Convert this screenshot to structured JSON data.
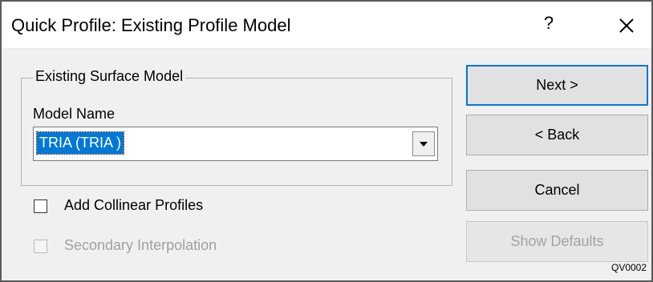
{
  "window": {
    "title": "Quick Profile: Existing Profile Model",
    "help_label": "?",
    "close_icon": "close-icon"
  },
  "group": {
    "legend": "Existing Surface Model",
    "model_name_label": "Model Name",
    "model_name_value": "TRIA (TRIA )",
    "dropdown_icon": "chevron-down-icon"
  },
  "options": {
    "add_collinear": {
      "label": "Add Collinear Profiles",
      "checked": false,
      "enabled": true
    },
    "secondary_interp": {
      "label": "Secondary Interpolation",
      "checked": false,
      "enabled": false
    }
  },
  "buttons": {
    "next": "Next >",
    "back": "< Back",
    "cancel": "Cancel",
    "show_defaults": "Show Defaults"
  },
  "footer_code": "QV0002",
  "colors": {
    "selection": "#0078d7",
    "dialog_bg": "#f0f0f0",
    "disabled_text": "#a0a0a0"
  }
}
